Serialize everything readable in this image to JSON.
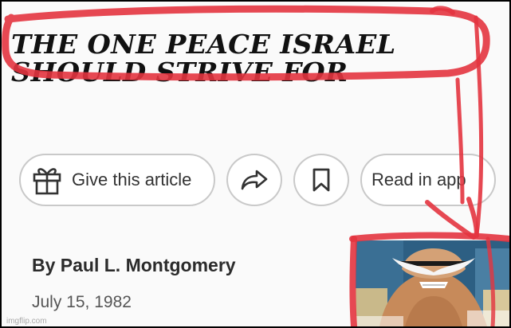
{
  "article": {
    "headline_line1": "THE ONE PEACE ISRAEL",
    "headline_line2": "SHOULD STRIVE FOR",
    "byline": "By Paul L. Montgomery",
    "date": "July 15, 1982"
  },
  "actions": {
    "gift_label": "Give this article",
    "read_in_app_label": "Read in app"
  },
  "icons": {
    "gift": "gift-icon",
    "share": "share-arrow-icon",
    "save": "bookmark-icon",
    "character": "whitebeard-character-image"
  },
  "watermark": "imgflip.com",
  "colors": {
    "annotation_red": "#e3343f",
    "pill_border": "#c9c9c9",
    "headline_text": "#111111"
  }
}
